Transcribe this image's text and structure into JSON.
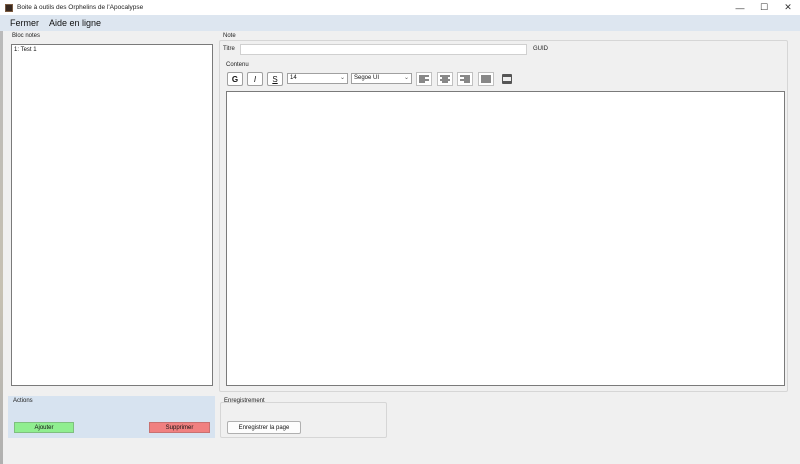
{
  "window": {
    "title": "Boite à outils des Orphelins de l'Apocalypse",
    "controls": [
      "—",
      "☐",
      "✕"
    ]
  },
  "menu": {
    "items": [
      "Fermer",
      "Aide en ligne"
    ]
  },
  "bloc_notes": {
    "label": "Bloc notes",
    "items": [
      "1: Test 1"
    ]
  },
  "note": {
    "label": "Note",
    "titre_label": "Titre",
    "titre_value": "",
    "guid_label": "GUID",
    "guid_value": "",
    "contenu_label": "Contenu"
  },
  "toolbar": {
    "bold": "G",
    "italic": "I",
    "strike": "S",
    "font_size": "14",
    "font_family": "Segoe UI",
    "align_left_icon": "align-left-icon",
    "align_center_icon": "align-center-icon",
    "align_right_icon": "align-right-icon",
    "align_justify_icon": "align-justify-icon",
    "pdf_icon": "pdf-icon"
  },
  "actions": {
    "label": "Actions",
    "add": "Ajouter",
    "delete": "Supprimer",
    "add_color": "#90ee90",
    "delete_color": "#f08080",
    "panel_color": "#d7e3f0"
  },
  "enregistrement": {
    "label": "Enregistrement",
    "save_page": "Enregistrer la page"
  }
}
